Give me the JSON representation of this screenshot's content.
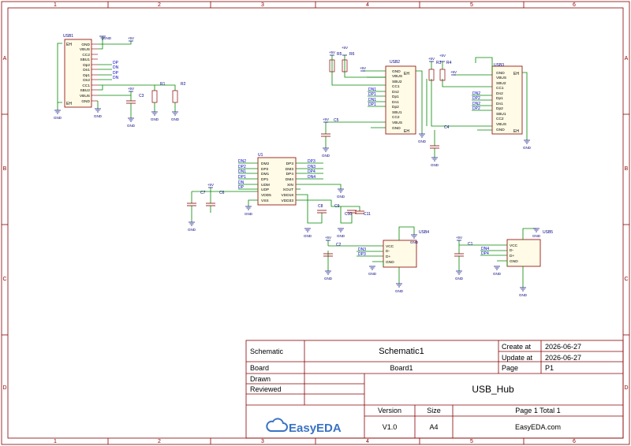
{
  "frame": {
    "cols": [
      "1",
      "2",
      "3",
      "4",
      "5",
      "6"
    ],
    "rows": [
      "A",
      "B",
      "C",
      "D"
    ]
  },
  "title_block": {
    "schematic_label": "Schematic",
    "schematic_name": "Schematic1",
    "create_label": "Create at",
    "create_date": "2026-06-27",
    "update_label": "Update at",
    "update_date": "2026-06-27",
    "board_label": "Board",
    "board_name": "Board1",
    "page_label": "Page",
    "page_value": "P1",
    "drawn_label": "Drawn",
    "reviewed_label": "Reviewed",
    "design_title": "USB_Hub",
    "version_label": "Version",
    "version_value": "V1.0",
    "size_label": "Size",
    "size_value": "A4",
    "page_total": "Page  1  Total  1",
    "website": "EasyEDA.com",
    "logo_text": "EasyEDA"
  },
  "components": {
    "usb1": {
      "ref": "USB1",
      "pins": [
        "GND",
        "VBUS",
        "CC2",
        "SBU1",
        "Dp2",
        "Dn1",
        "Dp1",
        "Dn2",
        "CC1",
        "SBU2",
        "VBUS",
        "GND"
      ],
      "eh": "EH"
    },
    "usb2": {
      "ref": "USB2",
      "pins": [
        "GND",
        "VBUS",
        "SBU2",
        "CC1",
        "Dn2",
        "Dp1",
        "Dn1",
        "Dp2",
        "SBU1",
        "CC2",
        "VBUS",
        "GND"
      ],
      "eh": "EH"
    },
    "usb3": {
      "ref": "USB3",
      "pins": [
        "GND",
        "VBUS",
        "SBU2",
        "CC1",
        "Dn2",
        "Dp1",
        "Dn1",
        "Dp2",
        "SBU1",
        "CC2",
        "VBUS",
        "GND"
      ],
      "eh": "EH"
    },
    "u1": {
      "ref": "U1",
      "left": [
        "DM2",
        "DP2",
        "DM1",
        "DP1",
        "UDM",
        "UDP",
        "VDD5",
        "VSS"
      ],
      "right": [
        "DP3",
        "DM3",
        "DP4",
        "DM4",
        "XIN",
        "XOUT",
        "VDD18",
        "VDD33"
      ]
    },
    "usb4": {
      "ref": "USB4",
      "pins": [
        "VCC",
        "D-",
        "D+",
        "GND"
      ]
    },
    "usb5": {
      "ref": "USB5",
      "pins": [
        "VCC",
        "D-",
        "D+",
        "GND"
      ]
    },
    "resistors": [
      "R1",
      "R2",
      "R5",
      "R6",
      "R3",
      "R4"
    ],
    "capacitors": [
      "C3",
      "C5",
      "C4",
      "C7",
      "C6",
      "C8",
      "C9",
      "C10",
      "C11",
      "C2",
      "C1"
    ]
  },
  "nets": {
    "gnd": "GND",
    "vplus": "+5V",
    "dp": "DP",
    "dn": "DN",
    "dn1": "DN1",
    "dp1": "DP1",
    "dn2": "DN2",
    "dp2": "DP2",
    "dn3": "DN3",
    "dp3": "DP3",
    "dn4": "DN4",
    "dp4": "DP4"
  },
  "colors": {
    "wire": "#008800",
    "component": "#8b0000",
    "pin_text": "#000080",
    "net_label": "#0000cc",
    "power": "#000080",
    "frame": "#880000"
  }
}
